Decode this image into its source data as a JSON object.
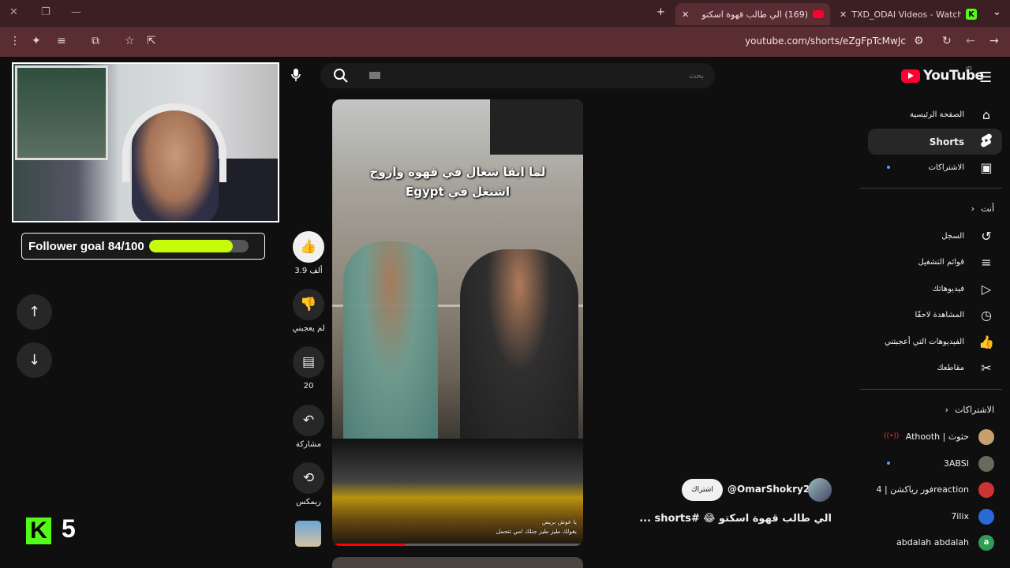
{
  "browser": {
    "tabs": [
      {
        "title": "(169) الي طالب قهوة اسكتو",
        "active": true
      },
      {
        "title": "TXD_ODAI Videos - Watch On",
        "active": false
      }
    ],
    "url": "youtube.com/shorts/eZgFpTcMwJc"
  },
  "search": {
    "placeholder": "بحث"
  },
  "youtube": {
    "logo": "YouTube",
    "country_code": "JO"
  },
  "sidebar": {
    "main": [
      {
        "label": "الصفحة الرئيسية",
        "icon": "home-icon"
      },
      {
        "label": "Shorts",
        "icon": "shorts-icon",
        "active": true
      },
      {
        "label": "الاشتراكات",
        "icon": "subscriptions-icon"
      }
    ],
    "you_header": "أنت",
    "you": [
      {
        "label": "السجل",
        "icon": "history-icon"
      },
      {
        "label": "قوائم التشغيل",
        "icon": "playlists-icon"
      },
      {
        "label": "فيديوهاتك",
        "icon": "your-videos-icon"
      },
      {
        "label": "المشاهدة لاحقًا",
        "icon": "watch-later-icon"
      },
      {
        "label": "الفيديوهات التي أعجبتني",
        "icon": "liked-videos-icon"
      },
      {
        "label": "مقاطعك",
        "icon": "clips-icon"
      }
    ],
    "subs_header": "الاشتراكات",
    "subscriptions": [
      {
        "name": "Athooth | حثوث",
        "avatar": "",
        "color": "#c8a070",
        "live": true
      },
      {
        "name": "3ABSI",
        "avatar": "",
        "color": "#6a6a5a"
      },
      {
        "name": "فور رياكشن | 4reaction",
        "avatar": "",
        "color": "#c33"
      },
      {
        "name": "7ilix",
        "avatar": "",
        "color": "#2a6ad8"
      },
      {
        "name": "abdalah abdalah",
        "avatar": "a",
        "color": "#2e9e55"
      }
    ]
  },
  "video": {
    "title_line1": "لما ابقا شغال في قهوه واروح",
    "title_line2": "اشتغل في Egypt",
    "subtitle_line1": "يا عوش بريض",
    "subtitle_line2": "بقولك طيز طيز جتلك امي تتحمل",
    "progress": 0.29
  },
  "actions": {
    "likes": "3.9 ألف",
    "dislike": "لم يعجبني",
    "comments": "20",
    "share": "مشاركة",
    "remix": "ريمكس"
  },
  "channel": {
    "handle": "@OmarShokry2",
    "subscribe": "اشتراك"
  },
  "caption": {
    "text": "الي طالب قهوة اسكتو 😂 #shorts ..."
  },
  "overlay": {
    "follower_label": "Follower goal 84/100",
    "follower_progress": 0.84,
    "kick_letter": "K",
    "kick_count": "5"
  }
}
